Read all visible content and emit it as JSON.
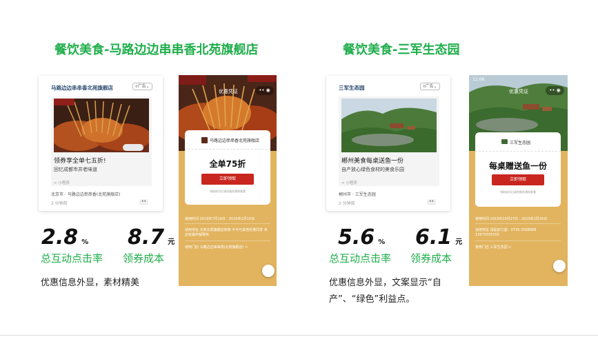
{
  "left": {
    "title": "餐饮美食-马路边边串串香北苑旗舰店",
    "card": {
      "header": "马路边边串串香北苑旗舰店",
      "location": "广告",
      "headline": "领券享全单七五折!",
      "subline": "回忆成都市井老味道",
      "tag": "小程序",
      "source": "北京市 · 马路边边串串香(北苑旗舰店)",
      "time": "2 分钟前",
      "more": "••"
    },
    "phone": {
      "page_title": "优惠凭证",
      "store": "马路边边串串香北苑旗舰店",
      "offer": "全单75折",
      "button": "立即领取",
      "hint": "领取成功后请到服务通知查看",
      "info_rows": [
        "使用时间  2019年7月19日 - 2020年2月19日",
        "适用地址  北苑北辰旗舰店使用 不可与其他优惠同享 本店有最终解释权",
        "使用门店  马路边边串串香(北苑旗舰店)  >"
      ]
    },
    "stats": [
      {
        "value": "2.8",
        "unit": "%",
        "label": "总互动点击率"
      },
      {
        "value": "8.7",
        "unit": "元",
        "label": "领券成本"
      }
    ],
    "desc": "优惠信息外显，素材精美"
  },
  "right": {
    "title": "餐饮美食-三军生态园",
    "card": {
      "header": "三军生态园",
      "location": "广告",
      "headline": "郴州美食每桌送鱼一份",
      "subline": "自产放心绿色食材的美食乐园",
      "tag": "小程序",
      "source": "郴州市 · 三军生态园",
      "time": "2 分钟前",
      "more": "••"
    },
    "phone": {
      "status_time": "11:06",
      "page_title": "优惠凭证",
      "store": "三军生态园",
      "offer": "每桌赠送鱼一份",
      "button": "立即领取",
      "hint": "领取成功后请到服务通知查看",
      "info_rows": [
        "使用时间  2019年10月27日 - 2020年1月26日",
        "适用地址  请提前订座：0735-2568888 13975555555",
        "使用门店  三军生态园  >"
      ]
    },
    "stats": [
      {
        "value": "5.6",
        "unit": "%",
        "label": "总互动点击率"
      },
      {
        "value": "6.1",
        "unit": "元",
        "label": "领券成本"
      }
    ],
    "desc_line1": "优惠信息外显，文案显示“自",
    "desc_line2": "产”、“绿色”利益点。"
  },
  "colors": {
    "accent": "#1fae4b",
    "coupon_bg": "#e2b45f",
    "button_red": "#c8261f"
  },
  "icons": [
    "location-icon",
    "mini-program-icon",
    "more-dots-icon",
    "capsule-menu-icon",
    "store-logo-icon",
    "floating-share-icon"
  ]
}
